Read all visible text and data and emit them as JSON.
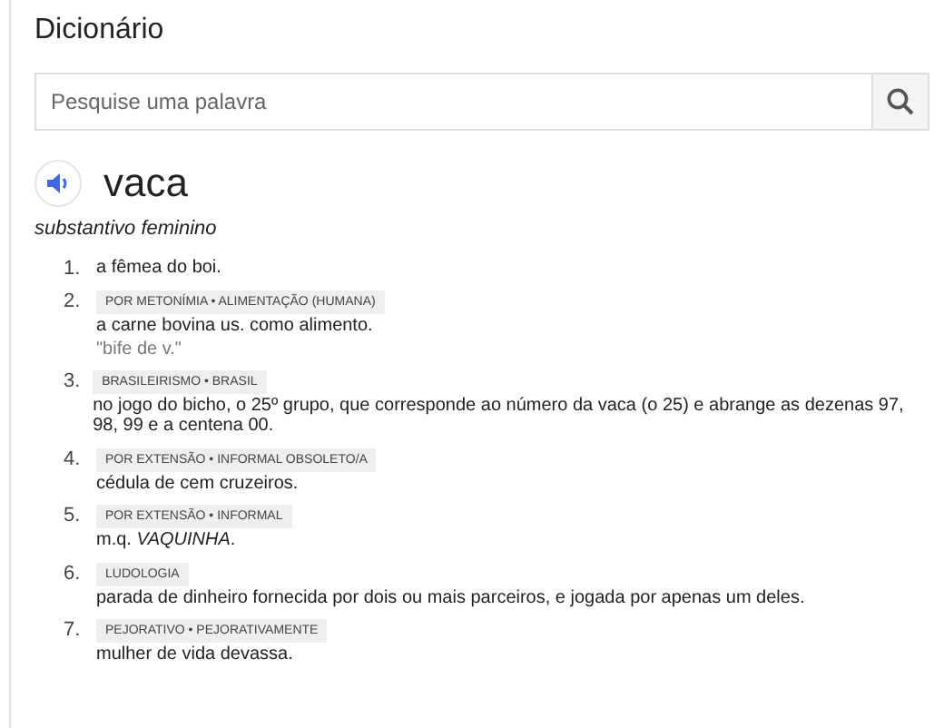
{
  "title": "Dicionário",
  "search": {
    "placeholder": "Pesquise uma palavra"
  },
  "word": "vaca",
  "part_of_speech": "substantivo feminino",
  "senses": [
    {
      "number": "1.",
      "definition": "a fêmea do boi."
    },
    {
      "number": "2.",
      "tags": "POR METONÍMIA • ALIMENTAÇÃO (HUMANA)",
      "definition": "a carne bovina us. como alimento.",
      "example": "\"bife de v.\""
    },
    {
      "number": "3.",
      "tags": "BRASILEIRISMO • BRASIL",
      "definition": "no jogo do bicho, o 25º grupo, que corresponde ao número da vaca (o 25) e abrange as dezenas 97, 98, 99 e a centena 00."
    },
    {
      "number": "4.",
      "tags": "POR EXTENSÃO • INFORMAL OBSOLETO/A",
      "definition": "cédula de cem cruzeiros."
    },
    {
      "number": "5.",
      "tags": "POR EXTENSÃO • INFORMAL",
      "definition": "m.q. *VAQUINHA*."
    },
    {
      "number": "6.",
      "tags": "LUDOLOGIA",
      "definition": "parada de dinheiro fornecida por dois ou mais parceiros, e jogada por apenas um deles."
    },
    {
      "number": "7.",
      "tags": "PEJORATIVO • PEJORATIVAMENTE",
      "definition": "mulher de vida devassa."
    }
  ]
}
